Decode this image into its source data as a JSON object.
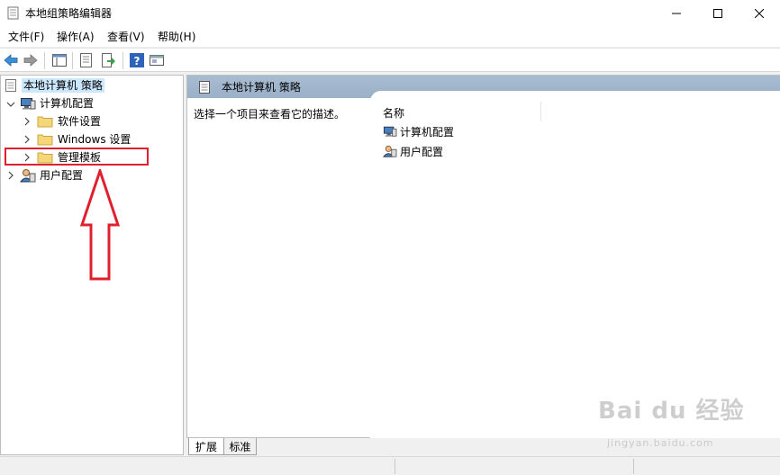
{
  "window": {
    "title": "本地组策略编辑器"
  },
  "menu": [
    "文件(F)",
    "操作(A)",
    "查看(V)",
    "帮助(H)"
  ],
  "tree": {
    "root": "本地计算机 策略",
    "computer_config": "计算机配置",
    "software_settings": "软件设置",
    "windows_settings": "Windows 设置",
    "admin_templates": "管理模板",
    "user_config": "用户配置"
  },
  "right_pane": {
    "header": "本地计算机 策略",
    "description": "选择一个项目来查看它的描述。",
    "column_name": "名称",
    "items": [
      "计算机配置",
      "用户配置"
    ]
  },
  "tabs": [
    "扩展",
    "标准"
  ],
  "watermark": {
    "main": "Bai du 经验",
    "sub": "jingyan.baidu.com"
  },
  "colors": {
    "selection": "#cce8ff",
    "header": "#a8bcd1",
    "annotation": "#e0202c",
    "folder": "#f5d77a"
  }
}
